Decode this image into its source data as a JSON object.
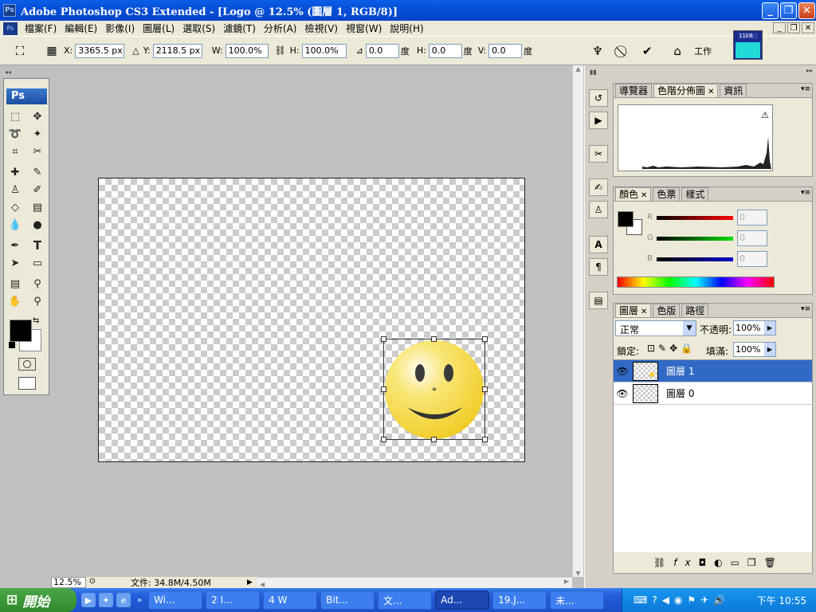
{
  "window": {
    "title": "Adobe Photoshop CS3 Extended - [Logo @ 12.5% (圖層 1, RGB/8)]",
    "app_icon": "Ps"
  },
  "menu": [
    "檔案(F)",
    "編輯(E)",
    "影像(I)",
    "圖層(L)",
    "選取(S)",
    "濾鏡(T)",
    "分析(A)",
    "檢視(V)",
    "視窗(W)",
    "說明(H)"
  ],
  "options": {
    "x_label": "X:",
    "x": "3365.5 px",
    "y_label": "Y:",
    "y": "2118.5 px",
    "w_label": "W:",
    "w": "100.0%",
    "h_label": "H:",
    "h": "100.0%",
    "angle": "0.0",
    "deg": "度",
    "skew_h_label": "H:",
    "skew_h": "0.0",
    "skew_v_label": "V:",
    "skew_v": "0.0",
    "workspace": "工作"
  },
  "status": {
    "zoom": "12.5%",
    "doc": "文件: 34.8M/4.50M"
  },
  "nav_panel": {
    "tabs": [
      "導覽器",
      "色階分佈圖",
      "資訊"
    ],
    "active": 1
  },
  "color_panel": {
    "tabs": [
      "顏色",
      "色票",
      "樣式"
    ],
    "r": "R",
    "g": "G",
    "b": "B",
    "r_val": "0",
    "g_val": "0",
    "b_val": "0"
  },
  "layers_panel": {
    "tabs": [
      "圖層",
      "色版",
      "路徑"
    ],
    "blend": "正常",
    "opacity_label": "不透明:",
    "opacity": "100%",
    "lock_label": "鎖定:",
    "fill_label": "填滿:",
    "fill": "100%",
    "layers": [
      {
        "name": "圖層 1",
        "selected": true
      },
      {
        "name": "圖層 0",
        "selected": false
      }
    ]
  },
  "taskbar": {
    "start": "開始",
    "tasks": [
      "Wi...",
      "2 I...",
      "4 W",
      "Bit...",
      "文...",
      "Ad...",
      "19.J...",
      "未..."
    ],
    "clock": "下午 10:55"
  },
  "colors": {
    "title": "#0a5ee8",
    "selected_layer": "#316ac5",
    "face": "#f5d83a"
  }
}
